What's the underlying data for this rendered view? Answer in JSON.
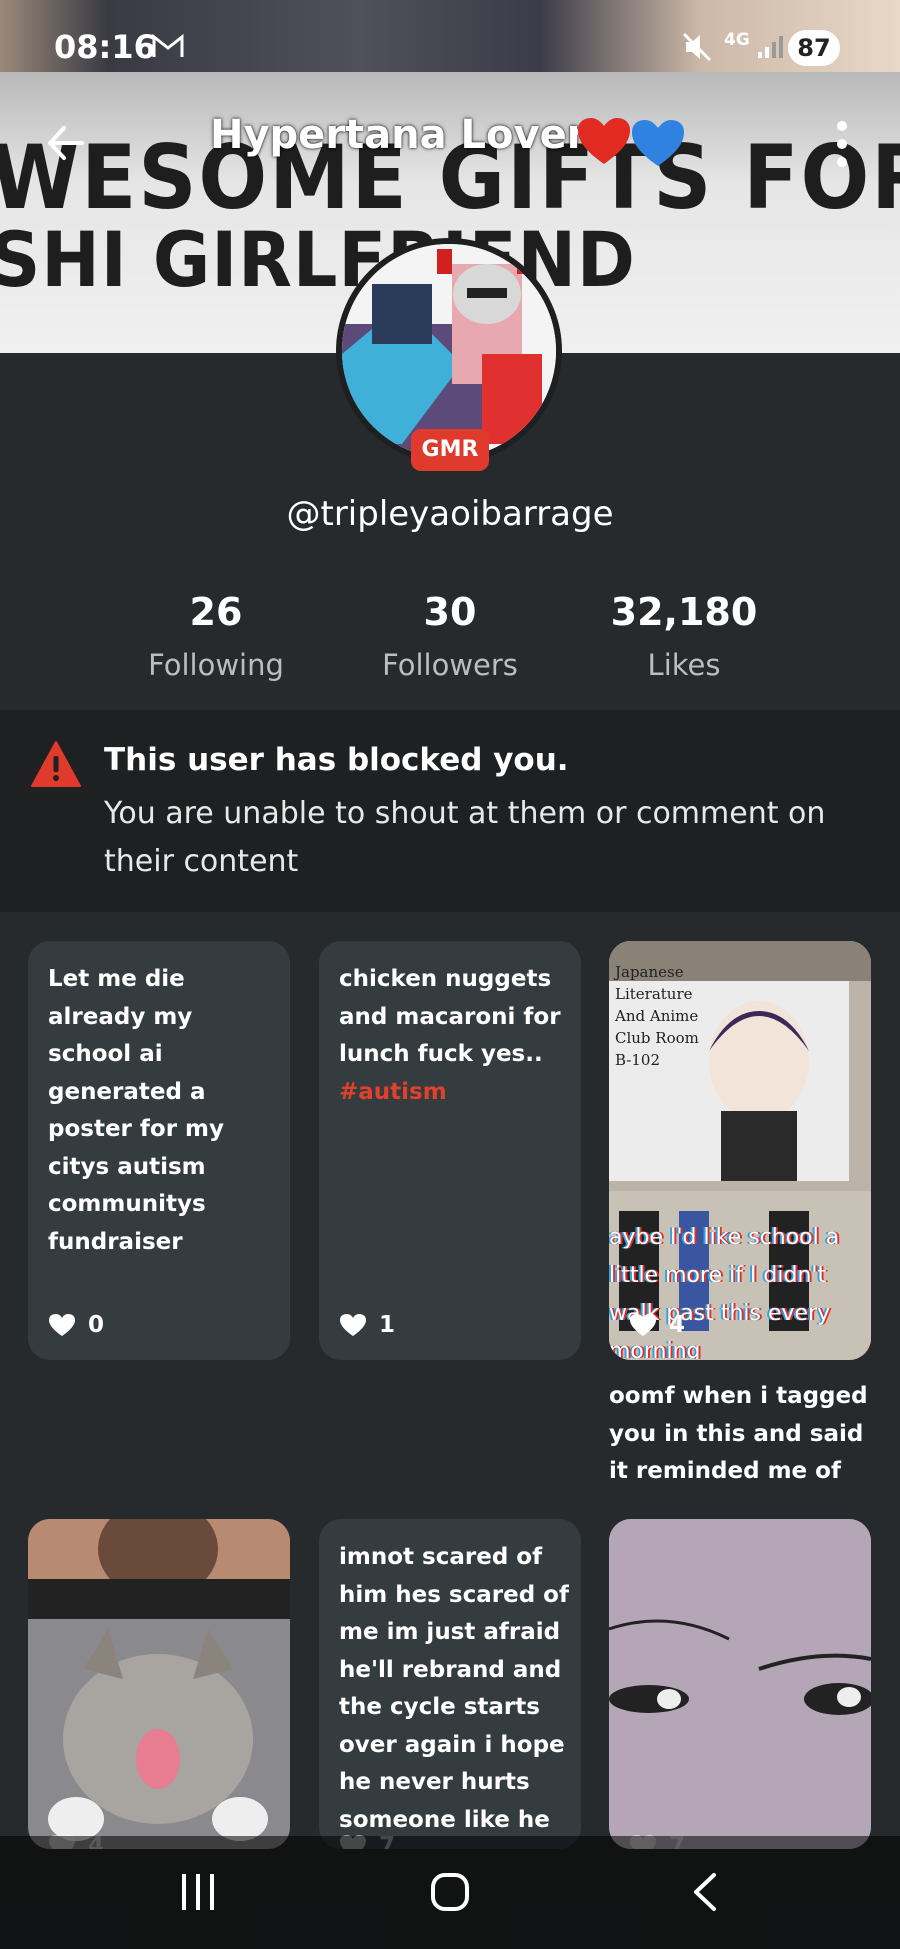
{
  "status_bar": {
    "time": "08:16",
    "network": "4G",
    "battery": "87"
  },
  "header": {
    "title": "Hypertana Lover"
  },
  "banner": {
    "line1": "WESOME GIFTS FOR YOU",
    "line2": "SHI GIRLFRIEND"
  },
  "profile": {
    "badge": "GMR",
    "handle": "@tripleyaoibarrage",
    "stats": [
      {
        "value": "26",
        "label": "Following"
      },
      {
        "value": "30",
        "label": "Followers"
      },
      {
        "value": "32,180",
        "label": "Likes"
      }
    ]
  },
  "notice": {
    "title": "This user has blocked you.",
    "body": "You are unable to shout at them or comment on their content"
  },
  "posts": [
    {
      "text": "Let me die already my school ai generated a poster for my citys autism communitys fundraiser",
      "likes": "0"
    },
    {
      "text": "chicken nuggets and macaroni for lunch fuck yes..",
      "tag": "#autism",
      "likes": "1"
    },
    {
      "image_text": "aybe I'd like school a little more if I didn't walk past this every morning",
      "poster_text": "Japanese Literature And Anime Club Room B-102",
      "likes": "4",
      "caption": "oomf when i tagged you in this and said it reminded me of y..."
    },
    {
      "likes": "4"
    },
    {
      "text": "imnot scared of him hes scared of me im just afraid he'll rebrand and the cycle starts over again i hope he never hurts someone like he",
      "likes": "7"
    },
    {
      "likes": "7"
    }
  ]
}
